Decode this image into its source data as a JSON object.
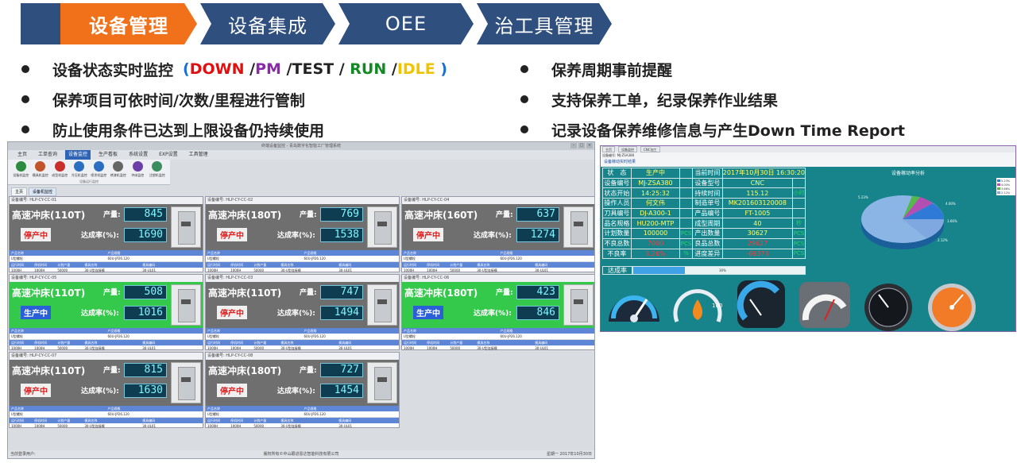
{
  "nav": {
    "tabs": [
      {
        "label": "设备管理",
        "active": true
      },
      {
        "label": "设备集成",
        "active": false
      },
      {
        "label": "OEE",
        "active": false
      },
      {
        "label": "治工具管理",
        "active": false
      }
    ]
  },
  "bullets_left": {
    "line1_text": "设备状态实时监控",
    "status_down": "DOWN",
    "status_pm": "PM",
    "status_test": "TEST",
    "status_run": "RUN",
    "status_idle": "IDLE",
    "line2": "保养项目可依时间/次数/里程进行管制",
    "line3": "防止使用条件已达到上限设备仍持续使用"
  },
  "bullets_right": {
    "line1": "保养周期事前提醒",
    "line2": "支持保养工单，纪录保养作业结果",
    "line3": "记录设备保养维修信息与产生Down Time Report"
  },
  "monitor": {
    "window_title": "终端设备监控 - 青岛数字化智能工厂管理系统",
    "menu": [
      "主页",
      "工单查询",
      "设备监控",
      "生产看板",
      "系统设置",
      "EXP设置",
      "工具管理"
    ],
    "active_menu": "设备监控",
    "ribbon_buttons": [
      "设备机监控",
      "模具机监控",
      "成型机监控",
      "冷压机监控",
      "喷涂机监控",
      "烤漆机监控",
      "冲床监控",
      "注塑机监控"
    ],
    "ribbon_group": "设备运行监控",
    "tabs": [
      "主页",
      "设备机监控"
    ],
    "label_output": "产量:",
    "label_rate": "达成率(%):",
    "table_header1": [
      "产品名称",
      "产品规格"
    ],
    "table_row1": [
      "U型螺栓",
      "60U-JP26.120"
    ],
    "table_header2": [
      "运行时间",
      "停机时间",
      "计划产量",
      "模具名称",
      "模具编码"
    ],
    "table_row2": [
      "1000H",
      "1000H",
      "50000",
      "30-U型连接模",
      "30-UL01"
    ],
    "panels": [
      {
        "id": "设备编号: HLP-CY-CC-01",
        "name": "高速冲床(110T)",
        "status": "停产中",
        "state": "stop",
        "output": "845",
        "rate": "1690"
      },
      {
        "id": "设备编号: HLP-CY-CC-02",
        "name": "高速冲床(180T)",
        "status": "停产中",
        "state": "stop",
        "output": "769",
        "rate": "1538"
      },
      {
        "id": "设备编号: HLP-CY-CC-04",
        "name": "高速冲床(160T)",
        "status": "停产中",
        "state": "stop",
        "output": "637",
        "rate": "1274"
      },
      {
        "id": "设备编号: HLP-CY-CC-05",
        "name": "高速冲床(110T)",
        "status": "生产中",
        "state": "run",
        "output": "508",
        "rate": "1016"
      },
      {
        "id": "设备编号: HLP-CY-CC-03",
        "name": "高速冲床(110T)",
        "status": "停产中",
        "state": "stop",
        "output": "747",
        "rate": "1494"
      },
      {
        "id": "设备编号: HLP-CY-CC-06",
        "name": "高速冲床(180T)",
        "status": "生产中",
        "state": "run",
        "output": "423",
        "rate": "846"
      },
      {
        "id": "设备编号: HLP-CY-CC-07",
        "name": "高速冲床(110T)",
        "status": "停产中",
        "state": "stop",
        "output": "815",
        "rate": "1630"
      },
      {
        "id": "设备编号: HLP-CY-CC-08",
        "name": "高速冲床(180T)",
        "status": "停产中",
        "state": "stop",
        "output": "727",
        "rate": "1454"
      }
    ],
    "status_left": "当前登录用户:",
    "status_center": "版权所有©中山跟进恩达智能科技有限公司",
    "status_right": "星期一   2017年10月30日"
  },
  "detail": {
    "tab1": "主页",
    "tab2": "设备监控",
    "tab3": "CNC加工",
    "sub_tab": "设备编号: MJ-ZSA380",
    "title": "设备稼动实时结果",
    "rows": [
      {
        "k1": "状　态",
        "v1": "生产中",
        "u1": "",
        "k2": "当前时间",
        "v2": "2017年10月30日 16:30:20",
        "u2": ""
      },
      {
        "k1": "设备编号",
        "v1": "MJ-ZSA380",
        "u1": "",
        "k2": "设备型号",
        "v2": "CNC",
        "u2": ""
      },
      {
        "k1": "状态开始",
        "v1": "14:25:32",
        "u1": "",
        "k2": "持续时间",
        "v2": "115.12",
        "u2": "小时"
      },
      {
        "k1": "操作人员",
        "v1": "何文伟",
        "u1": "",
        "k2": "制造单号",
        "v2": "MK201603120008",
        "u2": ""
      },
      {
        "k1": "刀具编号",
        "v1": "DJ-A300-1",
        "u1": "",
        "k2": "产品编号",
        "v2": "FT-1005",
        "u2": ""
      },
      {
        "k1": "品名规格",
        "v1": "HU200-MTP",
        "u1": "",
        "k2": "成型周期",
        "v2": "40",
        "u2": "秒"
      },
      {
        "k1": "计划数量",
        "v1": "100000",
        "u1": "PCS",
        "k2": "产出数量",
        "v2": "30627",
        "u2": "PCS"
      },
      {
        "k1": "不良总数",
        "v1": "7000",
        "u1": "PCS",
        "k2": "良品总数",
        "v2": "29627",
        "u2": "PCS"
      },
      {
        "k1": "不良率",
        "v1": "3.26%",
        "u1": "%",
        "k2": "进度差异",
        "v2": "-69373",
        "u2": "PCS"
      }
    ],
    "rate_label": "达成率",
    "rate_fraction": 0.3,
    "rate_text": "30%",
    "pie_title": "设备稼动率分析",
    "pie_labels": [
      "5.23%",
      "4.00%",
      "3.66%",
      "2.12%"
    ],
    "gauge_unit": "100"
  },
  "colors": {
    "nav_active": "#f0711a",
    "nav_normal": "#2f4f7f",
    "down": "#e01010",
    "pm": "#8a2aa8",
    "run": "#128a24",
    "idle": "#f0c400",
    "panel_stop": "#6f6f6f",
    "panel_run": "#35c94b",
    "detail_bg": "#16848a"
  }
}
